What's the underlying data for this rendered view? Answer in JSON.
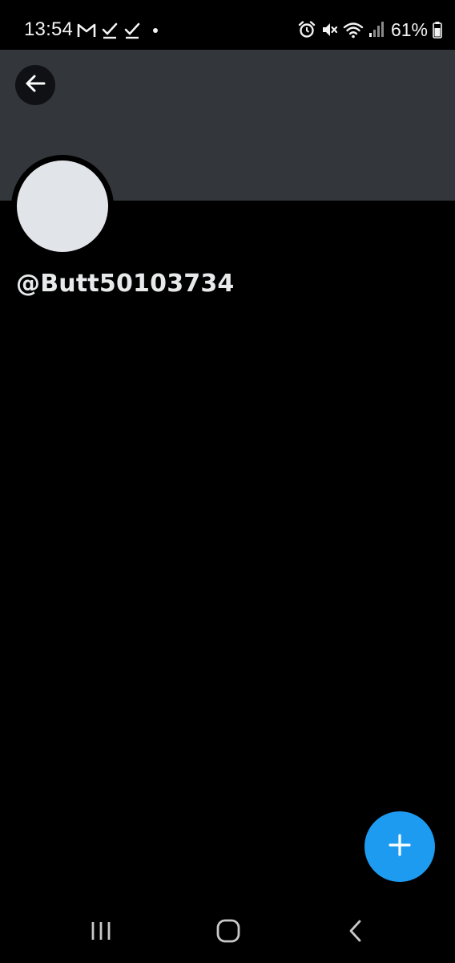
{
  "status_bar": {
    "time": "13:54",
    "battery_percent": "61%",
    "left_icons": [
      "gmail-icon",
      "check-icon",
      "check-icon",
      "dot-icon"
    ],
    "right_icons": [
      "alarm-icon",
      "mute-icon",
      "wifi-icon",
      "signal-icon",
      "battery-icon"
    ]
  },
  "profile": {
    "handle": "@Butt50103734"
  },
  "header": {
    "back_icon": "arrow-left-icon"
  },
  "fab": {
    "icon": "plus-icon"
  },
  "nav_bar": {
    "icons": [
      "recent-apps-icon",
      "home-icon",
      "back-icon"
    ]
  },
  "colors": {
    "background": "#000000",
    "banner": "#33373c",
    "avatar": "#e1e5ea",
    "accent": "#1d9bf0",
    "text": "#e7e9ea"
  }
}
